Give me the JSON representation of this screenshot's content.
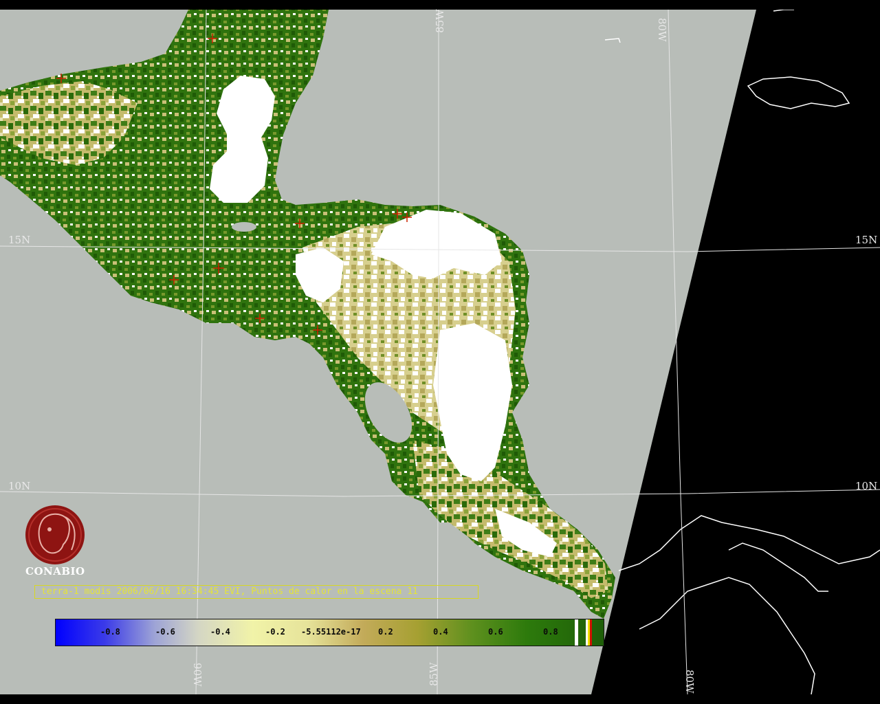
{
  "grid_labels": {
    "lat_15_left": "15N",
    "lat_15_right": "15N",
    "lat_10_left": "10N",
    "lat_10_right": "10N",
    "lon_85_top": "85W",
    "lon_80_top": "80W",
    "lon_90_bottom": "90W",
    "lon_85_bottom": "85W",
    "lon_80_bottom": "80W"
  },
  "logo": {
    "name": "CONABIO"
  },
  "caption": "terra-1 modis 2006/06/16 16:34:45 EVI, Puntos de calor en la escena 11",
  "colorbar": {
    "ticks": [
      "-0.8",
      "-0.6",
      "-0.4",
      "-0.2",
      "-5.55112e-17",
      "0.2",
      "0.4",
      "0.6",
      "0.8"
    ]
  },
  "colors": {
    "ocean": "#b8bdb8",
    "no_data": "#000000",
    "cloud": "#ffffff",
    "vegetation_dark": "#2d6e0c",
    "vegetation_light": "#c8bd6a",
    "hotspot": "#cc2200",
    "caption": "#e4e43a"
  }
}
